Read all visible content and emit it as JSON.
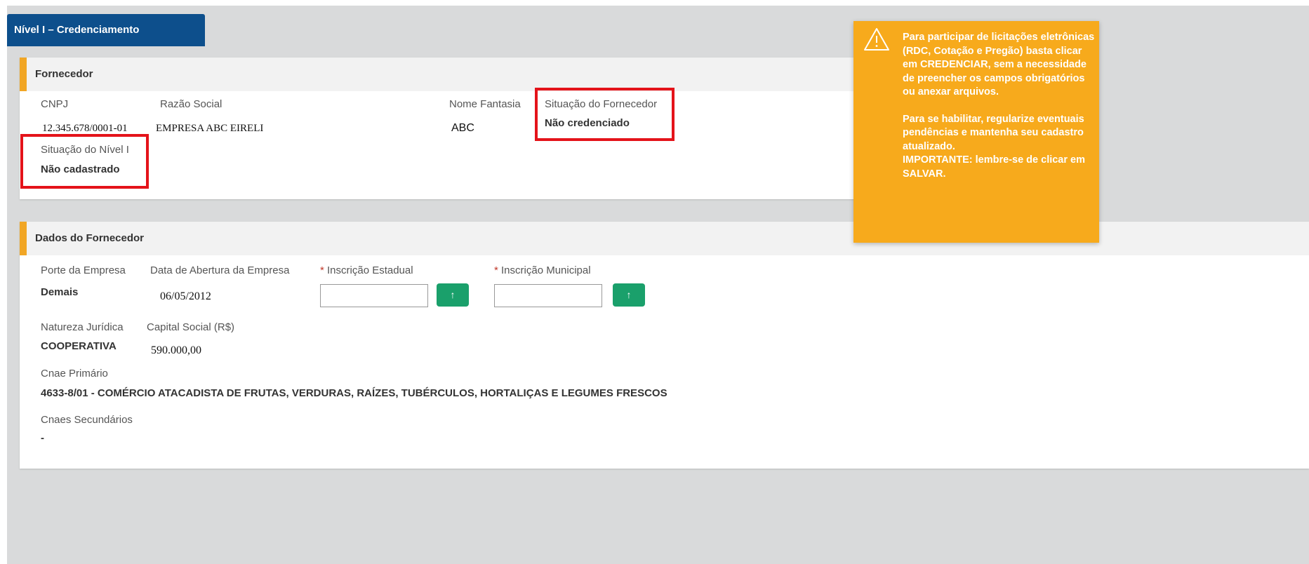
{
  "tab": {
    "title": "Nível I – Credenciamento"
  },
  "fornecedor": {
    "title": "Fornecedor",
    "cnpj_label": "CNPJ",
    "cnpj": "12.345.678/0001-01",
    "razao_label": "Razão Social",
    "razao": "EMPRESA ABC EIRELI",
    "fantasia_label": "Nome Fantasia",
    "fantasia": "ABC",
    "situacao_label": "Situação do Fornecedor",
    "situacao": "Não credenciado",
    "nivel_label": "Situação do Nível I",
    "nivel": "Não cadastrado"
  },
  "dados": {
    "title": "Dados do Fornecedor",
    "porte_label": "Porte da Empresa",
    "porte": "Demais",
    "abertura_label": "Data de Abertura da Empresa",
    "abertura": "06/05/2012",
    "ie_required": "*",
    "ie_label": "Inscrição Estadual",
    "ie_value": "",
    "im_required": "*",
    "im_label": "Inscrição Municipal",
    "im_value": "",
    "upload_icon": "↑",
    "natureza_label": "Natureza Jurídica",
    "natureza": "COOPERATIVA",
    "capital_label": "Capital Social (R$)",
    "capital": "590.000,00",
    "cnae_label": "Cnae Primário",
    "cnae": "4633-8/01 - COMÉRCIO ATACADISTA DE FRUTAS, VERDURAS, RAÍZES, TUBÉRCULOS, HORTALIÇAS E LEGUMES FRESCOS",
    "cnaes_sec_label": "Cnaes Secundários",
    "cnaes_sec": "-"
  },
  "alert": {
    "icon": "warning-triangle-icon",
    "p1": "Para participar de licitações eletrônicas (RDC, Cotação e Pregão) basta clicar em CREDENCIAR, sem a necessidade de preencher os campos obrigatórios ou anexar arquivos.",
    "p2": "Para se habilitar, regularize eventuais pendências e mantenha seu cadastro atualizado.",
    "p3": "IMPORTANTE: lembre-se de clicar em SALVAR."
  },
  "colors": {
    "tab": "#0d4f8c",
    "accent": "#f1a625",
    "alert": "#f7aa1c",
    "upload": "#1aa06b",
    "highlight": "#e4131a"
  }
}
